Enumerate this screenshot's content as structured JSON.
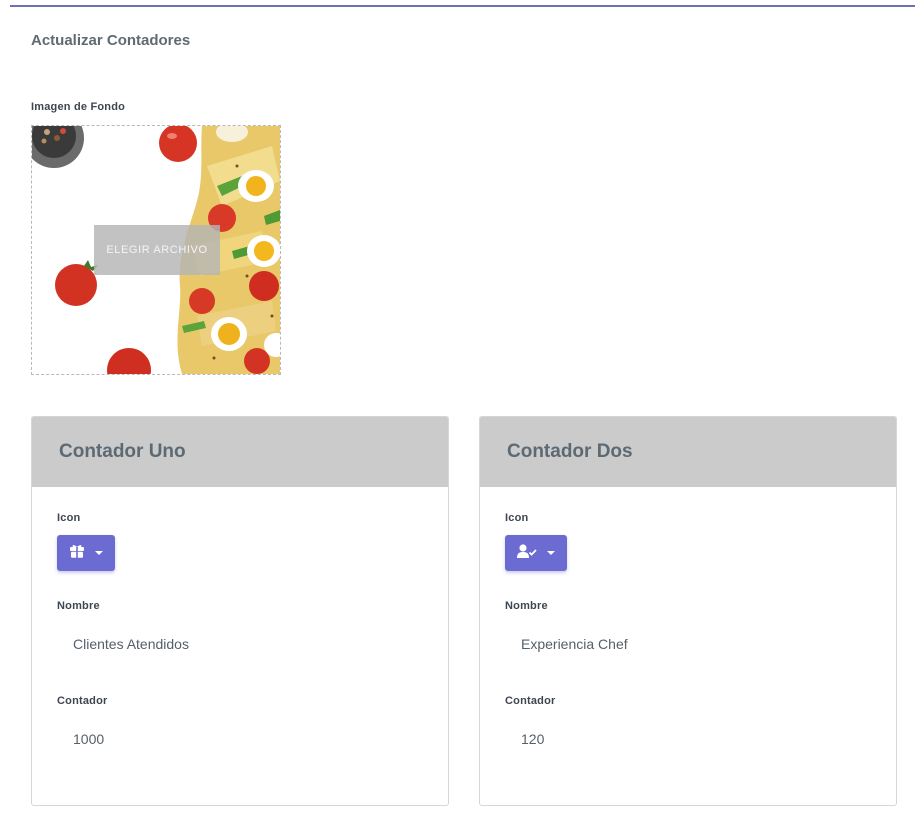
{
  "page": {
    "title": "Actualizar Contadores"
  },
  "background": {
    "label": "Imagen de Fondo",
    "button_label": "ELEGIR ARCHIVO"
  },
  "counters": [
    {
      "title": "Contador Uno",
      "icon_label": "Icon",
      "icon": "gift-icon",
      "name_label": "Nombre",
      "name_value": "Clientes Atendidos",
      "count_label": "Contador",
      "count_value": "1000"
    },
    {
      "title": "Contador Dos",
      "icon_label": "Icon",
      "icon": "user-check-icon",
      "name_label": "Nombre",
      "name_value": "Experiencia Chef",
      "count_label": "Contador",
      "count_value": "120"
    }
  ],
  "colors": {
    "accent": "#6c6bd1",
    "card_header": "#cbcbcb",
    "top_rule": "#6f6fb8"
  }
}
